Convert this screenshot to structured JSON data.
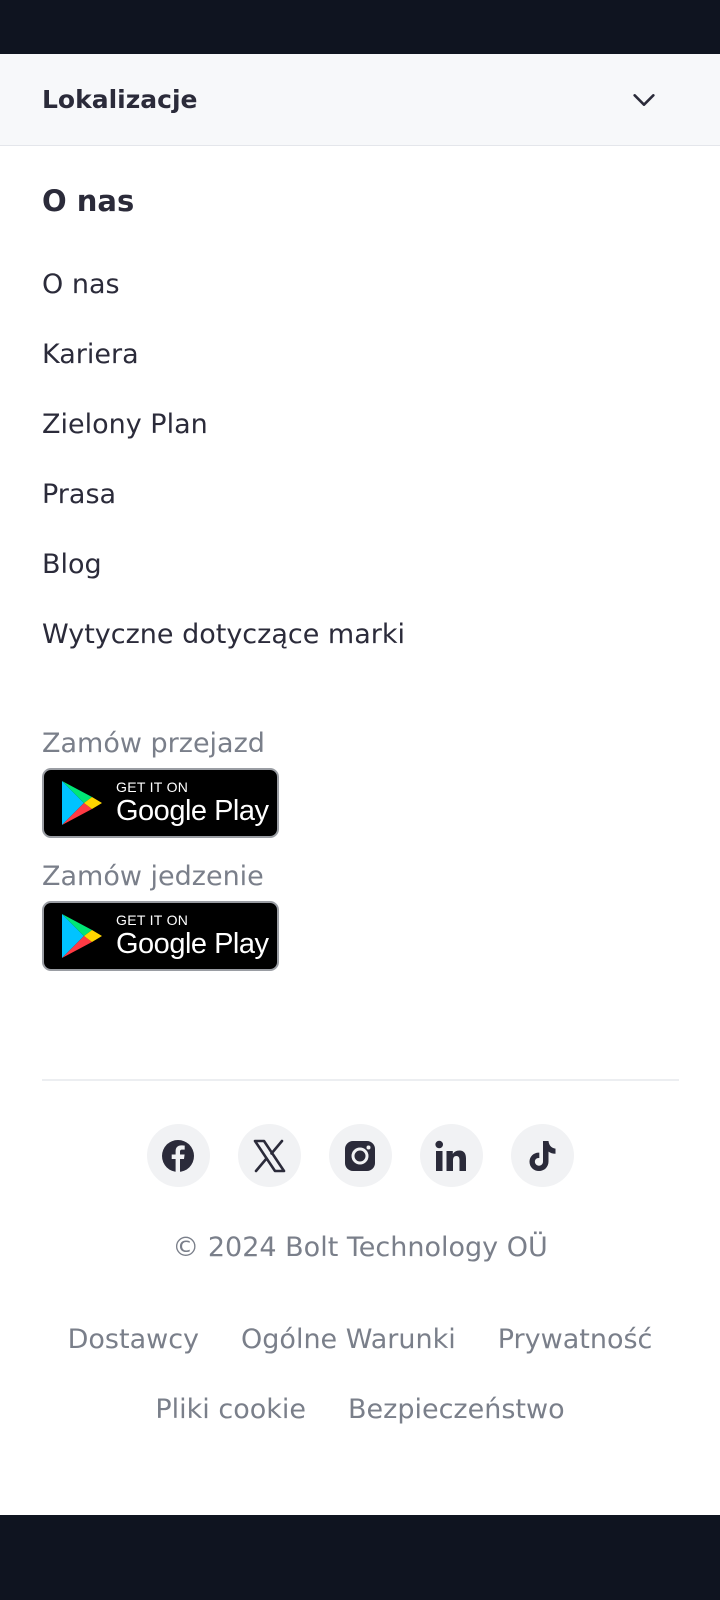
{
  "accordion": {
    "label": "Lokalizacje",
    "icon": "chevron-down-icon"
  },
  "about": {
    "title": "O nas",
    "links": [
      "O nas",
      "Kariera",
      "Zielony Plan",
      "Prasa",
      "Blog",
      "Wytyczne dotyczące marki"
    ]
  },
  "stores": [
    {
      "label": "Zamów przejazd",
      "badge_small": "GET IT ON",
      "badge_big": "Google Play"
    },
    {
      "label": "Zamów jedzenie",
      "badge_small": "GET IT ON",
      "badge_big": "Google Play"
    }
  ],
  "socials": [
    "facebook-icon",
    "x-icon",
    "instagram-icon",
    "linkedin-icon",
    "tiktok-icon"
  ],
  "footer": {
    "copyright": "© 2024 Bolt Technology OÜ",
    "legal_row1": [
      "Dostawcy",
      "Ogólne Warunki",
      "Prywatność"
    ],
    "legal_row2": [
      "Pliki cookie",
      "Bezpieczeństwo"
    ]
  },
  "colors": {
    "dark_bar": "#0f1420",
    "text": "#2b2b3a",
    "muted": "#7a7f8a"
  }
}
